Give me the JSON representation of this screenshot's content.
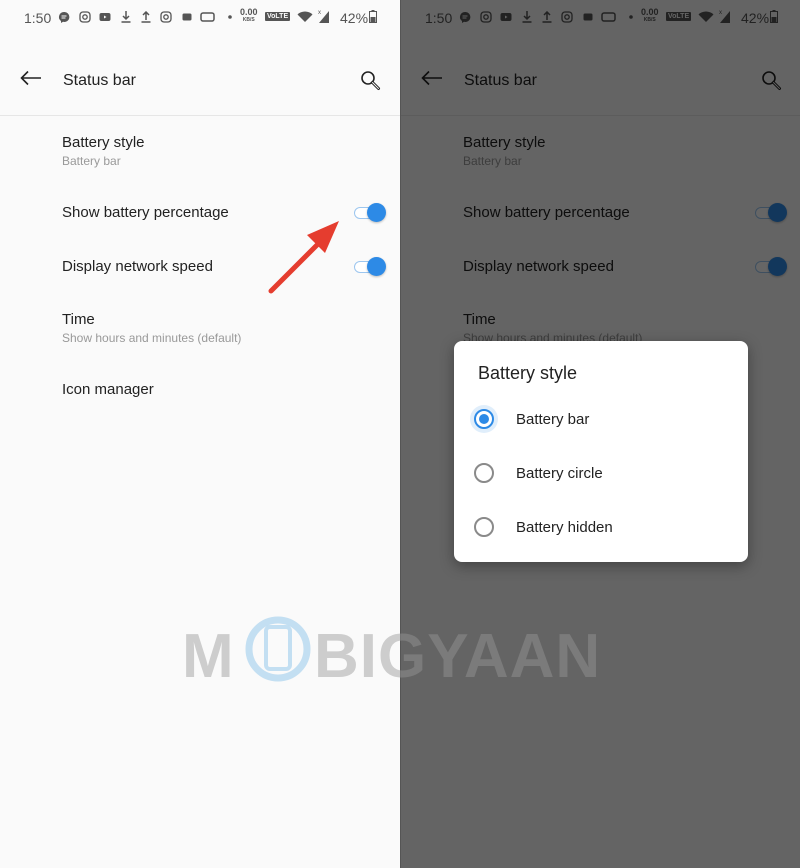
{
  "statusbar": {
    "time": "1:50",
    "net_speed_value": "0.00",
    "net_speed_unit": "KB/S",
    "network_badge": "VoLTE",
    "signal_label": "X",
    "battery_percent": "42%",
    "icons": [
      "message-icon",
      "instagram-icon",
      "youtube-icon",
      "download-icon",
      "upload-icon",
      "instagram-icon",
      "app-icon",
      "cast-icon",
      "dot-icon",
      "wifi-icon",
      "signal-icon",
      "battery-icon"
    ]
  },
  "appbar": {
    "title": "Status bar"
  },
  "settings": {
    "battery_style": {
      "label": "Battery style",
      "value": "Battery bar"
    },
    "show_battery_percentage": {
      "label": "Show battery percentage",
      "enabled": true
    },
    "display_network_speed": {
      "label": "Display network speed",
      "enabled": true
    },
    "time": {
      "label": "Time",
      "value": "Show hours and minutes (default)"
    },
    "icon_manager": {
      "label": "Icon manager"
    }
  },
  "dialog": {
    "title": "Battery style",
    "options": [
      {
        "label": "Battery bar",
        "selected": true
      },
      {
        "label": "Battery circle",
        "selected": false
      },
      {
        "label": "Battery hidden",
        "selected": false
      }
    ]
  },
  "watermark": {
    "text_left": "M",
    "text_right": "BIGYAAN"
  },
  "colors": {
    "accent": "#2d8ae6",
    "annotation_arrow": "#e53d2f",
    "background": "#fafafa"
  }
}
